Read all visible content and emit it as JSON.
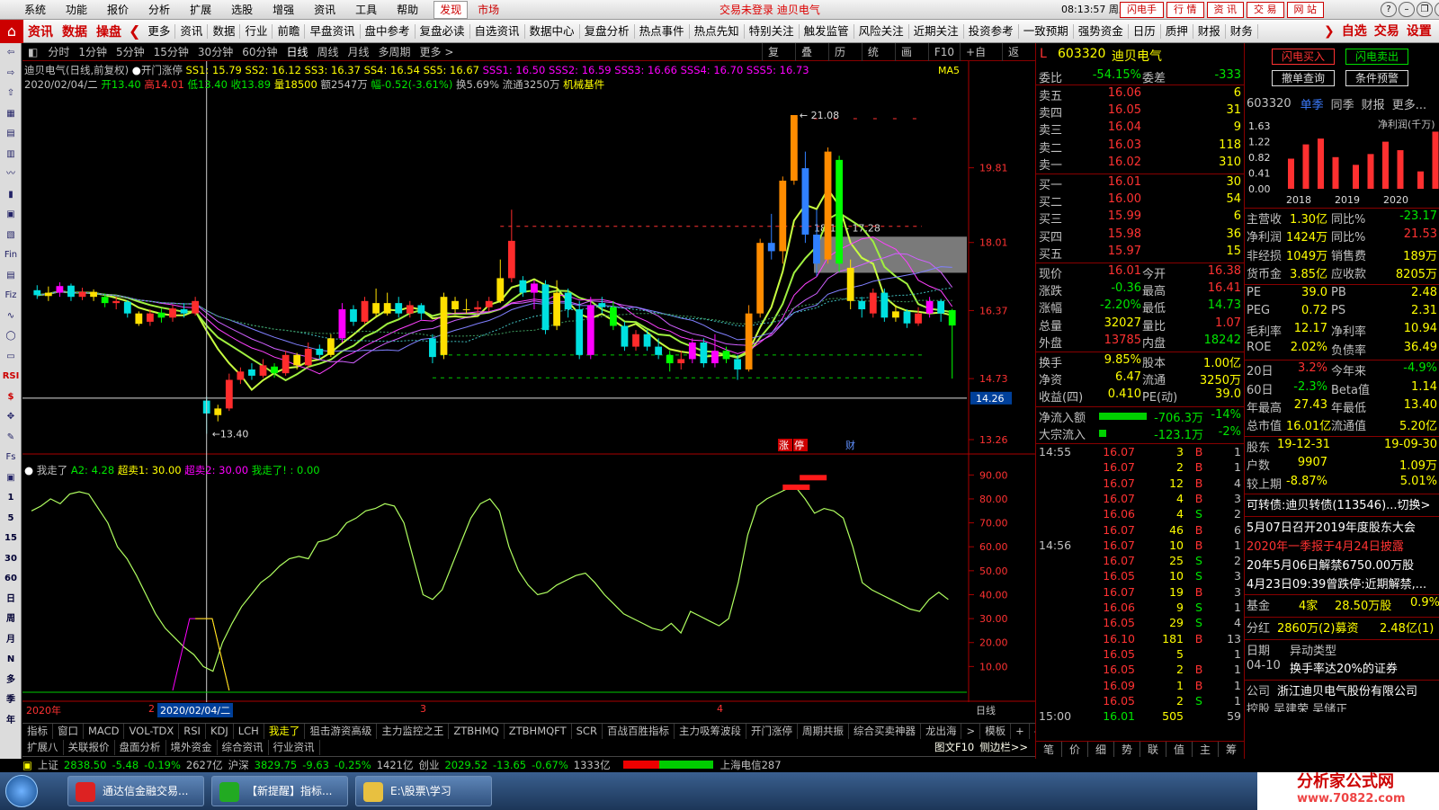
{
  "menubar": {
    "items": [
      "系统",
      "功能",
      "报价",
      "分析",
      "扩展",
      "选股",
      "增强",
      "资讯",
      "工具",
      "帮助"
    ],
    "find": "发现",
    "market": "市场",
    "status": "交易未登录  迪贝电气",
    "clock": "08:13:57 周五",
    "trade_buttons": [
      "闪电手",
      "行 情",
      "资 讯",
      "交 易",
      "网 站"
    ]
  },
  "navbar": {
    "big": [
      "资讯",
      "数据",
      "操盘"
    ],
    "items": [
      "更多",
      "资讯",
      "数据",
      "行业",
      "前瞻",
      "早盘资讯",
      "盘中参考",
      "复盘必读",
      "自选资讯",
      "数据中心",
      "复盘分析",
      "热点事件",
      "热点先知",
      "特别关注",
      "触发监管",
      "风险关注",
      "近期关注",
      "投资参考",
      "一致预期",
      "强势资金",
      "日历",
      "质押",
      "财报",
      "财务"
    ],
    "right": [
      "自选",
      "交易",
      "设置"
    ]
  },
  "lefttb": [
    "⇦",
    "⇨",
    "⇧",
    "▦",
    "▤",
    "▥",
    "〰",
    "▮",
    "▣",
    "▧",
    "Fin",
    "▤",
    "Fiz",
    "∿",
    "◯",
    "▭",
    "RSI",
    "$",
    "✥",
    "✎",
    "Fs",
    "▣",
    "1",
    "5",
    "15",
    "30",
    "60",
    "日",
    "周",
    "月",
    "N",
    "多",
    "季",
    "年"
  ],
  "periodbar": {
    "items": [
      "分时",
      "1分钟",
      "5分钟",
      "15分钟",
      "30分钟",
      "60分钟",
      "日线",
      "周线",
      "月线",
      "多周期",
      "更多 >"
    ],
    "active": 6,
    "tools": [
      "复权",
      "叠加",
      "历史",
      "统计",
      "画线",
      "F10",
      "+自选",
      "返回"
    ]
  },
  "chartinfo": {
    "name": "迪贝电气(日线,前复权)",
    "formula": "开门涨停",
    "ss": "SS1: 15.79  SS2: 16.12  SS3: 16.37  SS4: 16.54  SS5: 16.67",
    "sss": "SSS1: 16.50  SSS2: 16.59  SSS3: 16.66  SSS4: 16.70  SSS5: 16.73",
    "ma": "MA5",
    "date": "2020/02/04/二",
    "open": "开13.40",
    "high": "高14.01",
    "low": "低13.40",
    "close": "收13.89",
    "vol": "量18500",
    "amt": "额2547万",
    "chg": "幅-0.52(-3.61%)",
    "turn": "换5.69%",
    "float": "流通3250万",
    "industry": "机械基件"
  },
  "indicator": {
    "name": "我走了",
    "a2": "A2: 4.28",
    "cs1": "超卖1: 30.00",
    "cs2": "超卖2: 30.00",
    "wz": "我走了! : 0.00"
  },
  "dateaxis": {
    "labels": [
      "2020年",
      "2",
      "2020/02/04/二",
      "3",
      "4"
    ],
    "right": "日线"
  },
  "indtabs": [
    "指标",
    "窗口",
    "MACD",
    "VOL-TDX",
    "RSI",
    "KDJ",
    "LCH",
    "我走了",
    "狙击游资高级",
    "主力监控之王",
    "ZTBHMQ",
    "ZTBHMQFT",
    "SCR",
    "百战百胜指标",
    "主力吸筹波段",
    "开门涨停",
    "周期共振",
    "综合买卖神器",
    "龙出海",
    ">",
    "模板",
    "+",
    "-"
  ],
  "indtabs2": [
    "扩展八",
    "关联报价",
    "盘面分析",
    "境外资金",
    "综合资讯",
    "行业资讯"
  ],
  "indtabs2_right": [
    "图文F10",
    "侧边栏>>"
  ],
  "statusbar": {
    "sh": "上证",
    "sh_v": "2838.50",
    "sh_c": "-5.48",
    "sh_p": "-0.19%",
    "sh_a": "2627亿",
    "hs": "沪深",
    "hs_v": "3829.75",
    "hs_c": "-9.63",
    "hs_p": "-0.25%",
    "hs_a": "1421亿",
    "cy": "创业",
    "cy_v": "2029.52",
    "cy_c": "-13.65",
    "cy_p": "-0.67%",
    "cy_a": "1333亿",
    "tel": "上海电信287"
  },
  "taskbar": [
    "通达信金融交易...",
    "【新提醒】指标...",
    "E:\\股票\\学习"
  ],
  "logo": {
    "t1": "分析家公式网",
    "t2": "www.70822.com"
  },
  "quote": {
    "mark": "L",
    "code": "603320",
    "name": "迪贝电气",
    "wb": {
      "l": "委比",
      "v": "-54.15%",
      "l2": "委差",
      "v2": "-333"
    },
    "asks": [
      {
        "l": "卖五",
        "p": "16.06",
        "v": "6"
      },
      {
        "l": "卖四",
        "p": "16.05",
        "v": "31"
      },
      {
        "l": "卖三",
        "p": "16.04",
        "v": "9"
      },
      {
        "l": "卖二",
        "p": "16.03",
        "v": "118"
      },
      {
        "l": "卖一",
        "p": "16.02",
        "v": "310"
      }
    ],
    "bids": [
      {
        "l": "买一",
        "p": "16.01",
        "v": "30"
      },
      {
        "l": "买二",
        "p": "16.00",
        "v": "54"
      },
      {
        "l": "买三",
        "p": "15.99",
        "v": "6"
      },
      {
        "l": "买四",
        "p": "15.98",
        "v": "36"
      },
      {
        "l": "买五",
        "p": "15.97",
        "v": "15"
      }
    ],
    "stats": [
      {
        "l": "现价",
        "v": "16.01",
        "vc": "red",
        "l2": "今开",
        "v2": "16.38",
        "v2c": "red"
      },
      {
        "l": "涨跌",
        "v": "-0.36",
        "vc": "grn",
        "l2": "最高",
        "v2": "16.41",
        "v2c": "red"
      },
      {
        "l": "涨幅",
        "v": "-2.20%",
        "vc": "grn",
        "l2": "最低",
        "v2": "14.73",
        "v2c": "grn"
      },
      {
        "l": "总量",
        "v": "32027",
        "vc": "yel",
        "l2": "量比",
        "v2": "1.07",
        "v2c": "red"
      },
      {
        "l": "外盘",
        "v": "13785",
        "vc": "red",
        "l2": "内盘",
        "v2": "18242",
        "v2c": "grn"
      }
    ],
    "stats2": [
      {
        "l": "换手",
        "v": "9.85%",
        "l2": "股本",
        "v2": "1.00亿"
      },
      {
        "l": "净资",
        "v": "6.47",
        "l2": "流通",
        "v2": "3250万"
      },
      {
        "l": "收益(四)",
        "v": "0.410",
        "l2": "PE(动)",
        "v2": "39.0"
      }
    ],
    "flow": [
      {
        "l": "净流入额",
        "v": "-706.3万",
        "p": "-14%",
        "bar": 0.75
      },
      {
        "l": "大宗流入",
        "v": "-123.1万",
        "p": "-2%",
        "bar": 0.12
      }
    ],
    "ticks": [
      {
        "t": "14:55",
        "p": "16.07",
        "v": "3",
        "bs": "B",
        "c": "1"
      },
      {
        "t": "",
        "p": "16.07",
        "v": "2",
        "bs": "B",
        "c": "1"
      },
      {
        "t": "",
        "p": "16.07",
        "v": "12",
        "bs": "B",
        "c": "4"
      },
      {
        "t": "",
        "p": "16.07",
        "v": "4",
        "bs": "B",
        "c": "3"
      },
      {
        "t": "",
        "p": "16.06",
        "v": "4",
        "bs": "S",
        "c": "2"
      },
      {
        "t": "",
        "p": "16.07",
        "v": "46",
        "bs": "B",
        "c": "6"
      },
      {
        "t": "14:56",
        "p": "16.07",
        "v": "10",
        "bs": "B",
        "c": "1"
      },
      {
        "t": "",
        "p": "16.07",
        "v": "25",
        "bs": "S",
        "c": "2"
      },
      {
        "t": "",
        "p": "16.05",
        "v": "10",
        "bs": "S",
        "c": "3"
      },
      {
        "t": "",
        "p": "16.07",
        "v": "19",
        "bs": "B",
        "c": "3"
      },
      {
        "t": "",
        "p": "16.06",
        "v": "9",
        "bs": "S",
        "c": "1"
      },
      {
        "t": "",
        "p": "16.05",
        "v": "29",
        "bs": "S",
        "c": "4"
      },
      {
        "t": "",
        "p": "16.10",
        "v": "181",
        "bs": "B",
        "c": "13"
      },
      {
        "t": "",
        "p": "16.05",
        "v": "5",
        "bs": "",
        "c": "1"
      },
      {
        "t": "",
        "p": "16.05",
        "v": "2",
        "bs": "B",
        "c": "1"
      },
      {
        "t": "",
        "p": "16.09",
        "v": "1",
        "bs": "B",
        "c": "1"
      },
      {
        "t": "",
        "p": "16.05",
        "v": "2",
        "bs": "S",
        "c": "1"
      },
      {
        "t": "15:00",
        "p": "16.01",
        "v": "505",
        "bs": "",
        "c": "59"
      }
    ],
    "tabs": [
      "笔",
      "价",
      "细",
      "势",
      "联",
      "值",
      "主",
      "筹"
    ]
  },
  "info": {
    "buttons": [
      "闪电买入",
      "闪电卖出",
      "撤单查询",
      "条件预警"
    ],
    "code": "603320",
    "tabs": [
      "单季",
      "同季",
      "财报",
      "更多..."
    ],
    "chart_title": "净利润(千万)",
    "yticks": [
      "1.63",
      "1.22",
      "0.82",
      "0.41",
      "0.00"
    ],
    "years": [
      "2018",
      "2019",
      "2020"
    ],
    "bars": [
      0.78,
      1.15,
      1.3,
      0.82,
      0.62,
      0.9,
      1.22,
      1.0,
      0.45,
      1.48
    ],
    "rows1": [
      {
        "l": "主营收",
        "v": "1.30亿",
        "l2": "同比%",
        "v2": "-23.17",
        "v2c": "grn"
      },
      {
        "l": "净利润",
        "v": "1424万",
        "l2": "同比%",
        "v2": "21.53",
        "v2c": "red"
      },
      {
        "l": "非经损",
        "v": "1049万",
        "l2": "销售费",
        "v2": "189万",
        "v2c": "yel"
      },
      {
        "l": "货币金",
        "v": "3.85亿",
        "l2": "应收款",
        "v2": "8205万",
        "v2c": "yel"
      }
    ],
    "rows2": [
      {
        "l": "PE",
        "v": "39.0",
        "l2": "PB",
        "v2": "2.48"
      },
      {
        "l": "PEG",
        "v": "0.72",
        "l2": "PS",
        "v2": "2.31"
      },
      {
        "l": "毛利率",
        "v": "12.17",
        "l2": "净利率",
        "v2": "10.94"
      },
      {
        "l": "ROE",
        "v": "2.02%",
        "l2": "负债率",
        "v2": "36.49"
      }
    ],
    "rows3": [
      {
        "l": "20日",
        "v": "3.2%",
        "vc": "red",
        "l2": "今年来",
        "v2": "-4.9%",
        "v2c": "grn"
      },
      {
        "l": "60日",
        "v": "-2.3%",
        "vc": "grn",
        "l2": "Beta值",
        "v2": "1.14",
        "v2c": "yel"
      },
      {
        "l": "年最高",
        "v": "27.43",
        "vc": "yel",
        "l2": "年最低",
        "v2": "13.40",
        "v2c": "yel"
      },
      {
        "l": "总市值",
        "v": "16.01亿",
        "vc": "yel",
        "l2": "流通值",
        "v2": "5.20亿",
        "v2c": "yel"
      }
    ],
    "rows4": [
      {
        "l": "股东",
        "v": "19-12-31",
        "l2": "",
        "v2": "19-09-30"
      },
      {
        "l": "户数",
        "v": "9907",
        "l2": "",
        "v2": "1.09万"
      },
      {
        "l": "较上期",
        "v": "-8.87%",
        "l2": "",
        "v2": "5.01%"
      }
    ],
    "bond": "可转债:迪贝转债(113546)...切换>",
    "news": [
      {
        "t": "5月07日召开2019年度股东大会",
        "c": "wht"
      },
      {
        "t": "2020年一季报于4月24日披露",
        "c": "red"
      },
      {
        "t": "20年5月06日解禁6750.00万股",
        "c": "wht"
      },
      {
        "t": "4月23日09:39曾跌停:近期解禁,...",
        "c": "wht"
      }
    ],
    "fund": {
      "l": "基金",
      "v": "4家",
      "v2": "28.50万股",
      "v3": "0.9%"
    },
    "div": {
      "l": "分红",
      "v": "2860万(2)募资",
      "v2": "2.48亿(1)"
    },
    "event": {
      "l": "日期",
      "v": "异动类型",
      "l2": "04-10",
      "v2": "换手率达20%的证券"
    },
    "company": {
      "l": "公司",
      "v": "浙江迪贝电气股份有限公司"
    },
    "last": "控股  吴建荣  吴储正"
  },
  "chart_data": {
    "type": "candlestick",
    "series_name": "迪贝电气(日线,前复权)",
    "y_ticks": [
      "19.81",
      "18.01",
      "16.37",
      "14.73",
      "13.26"
    ],
    "y_min": 13.0,
    "y_max": 21.6,
    "last_price_label": "14.26",
    "annotations": {
      "high": "21.08",
      "low": "13.40",
      "range": "18.15 - 17.28",
      "zhang": "涨",
      "ting": "停",
      "cai": "财"
    },
    "candles": [
      [
        16.86,
        16.74,
        16.98,
        16.65
      ],
      [
        16.72,
        16.8,
        16.95,
        16.6
      ],
      [
        16.8,
        16.96,
        17.05,
        16.7
      ],
      [
        16.97,
        16.7,
        17.02,
        16.6
      ],
      [
        16.7,
        16.82,
        16.92,
        16.62
      ],
      [
        16.82,
        16.7,
        16.88,
        16.6
      ],
      [
        16.7,
        16.55,
        16.78,
        16.45
      ],
      [
        16.55,
        16.6,
        16.7,
        16.4
      ],
      [
        16.58,
        16.3,
        16.62,
        16.2
      ],
      [
        16.3,
        16.05,
        16.35,
        16.0
      ],
      [
        16.1,
        16.3,
        16.4,
        16.0
      ],
      [
        16.32,
        16.2,
        16.42,
        16.08
      ],
      [
        16.2,
        16.42,
        16.5,
        16.1
      ],
      [
        16.4,
        16.3,
        16.55,
        16.2
      ],
      [
        16.3,
        16.6,
        16.7,
        16.25
      ],
      [
        14.2,
        13.89,
        14.3,
        13.4
      ],
      [
        13.85,
        14.01,
        14.1,
        13.7
      ],
      [
        14.01,
        14.7,
        14.85,
        13.95
      ],
      [
        14.7,
        14.9,
        15.0,
        14.6
      ],
      [
        14.95,
        14.8,
        15.1,
        14.7
      ],
      [
        14.8,
        15.05,
        15.2,
        14.75
      ],
      [
        15.02,
        14.86,
        15.1,
        14.75
      ],
      [
        14.86,
        15.3,
        15.4,
        14.8
      ],
      [
        15.3,
        15.05,
        15.35,
        14.95
      ],
      [
        15.05,
        15.45,
        15.6,
        15.0
      ],
      [
        15.45,
        15.3,
        15.55,
        15.2
      ],
      [
        15.3,
        15.7,
        15.8,
        15.25
      ],
      [
        15.7,
        16.4,
        16.55,
        15.6
      ],
      [
        16.4,
        16.1,
        16.5,
        16.0
      ],
      [
        16.1,
        16.6,
        16.7,
        16.05
      ],
      [
        16.55,
        16.3,
        16.9,
        16.2
      ],
      [
        16.3,
        16.55,
        16.8,
        16.25
      ],
      [
        16.55,
        16.3,
        16.7,
        16.2
      ],
      [
        16.3,
        16.5,
        16.6,
        16.2
      ],
      [
        16.5,
        16.3,
        16.55,
        16.15
      ],
      [
        15.7,
        15.25,
        15.8,
        15.1
      ],
      [
        15.3,
        16.7,
        16.8,
        15.2
      ],
      [
        16.6,
        16.4,
        16.7,
        16.3
      ],
      [
        16.4,
        16.38,
        16.65,
        16.3
      ],
      [
        16.4,
        16.45,
        16.6,
        16.3
      ],
      [
        16.45,
        16.6,
        16.7,
        16.35
      ],
      [
        16.6,
        17.15,
        17.6,
        16.55
      ],
      [
        17.15,
        18.05,
        18.8,
        17.05
      ],
      [
        17.1,
        16.8,
        17.2,
        16.7
      ],
      [
        16.8,
        17.02,
        17.1,
        16.4
      ],
      [
        17.0,
        15.9,
        17.1,
        15.8
      ],
      [
        16.0,
        16.8,
        17.1,
        15.9
      ],
      [
        16.8,
        16.4,
        16.9,
        16.2
      ],
      [
        16.4,
        15.3,
        16.6,
        15.2
      ],
      [
        15.3,
        16.5,
        16.7,
        15.2
      ],
      [
        16.55,
        16.45,
        16.7,
        16.3
      ],
      [
        16.45,
        16.0,
        16.6,
        15.9
      ],
      [
        16.0,
        15.5,
        16.1,
        15.4
      ],
      [
        15.5,
        15.8,
        15.9,
        15.4
      ],
      [
        15.8,
        15.5,
        15.9,
        15.4
      ],
      [
        15.5,
        15.3,
        15.7,
        15.2
      ],
      [
        15.3,
        15.1,
        15.4,
        14.9
      ],
      [
        15.1,
        15.2,
        15.4,
        14.95
      ],
      [
        15.2,
        15.6,
        15.7,
        15.1
      ],
      [
        15.6,
        15.1,
        15.7,
        15.0
      ],
      [
        15.1,
        15.4,
        15.8,
        15.0
      ],
      [
        15.4,
        15.2,
        15.5,
        15.1
      ],
      [
        15.2,
        14.95,
        15.3,
        14.7
      ],
      [
        14.95,
        16.3,
        16.5,
        14.9
      ],
      [
        16.3,
        18.0,
        18.1,
        16.2
      ],
      [
        18.0,
        17.8,
        18.7,
        17.6
      ],
      [
        17.8,
        19.5,
        19.6,
        17.5
      ],
      [
        19.5,
        21.08,
        21.08,
        19.4
      ],
      [
        19.8,
        18.2,
        20.2,
        18.0
      ],
      [
        18.2,
        17.5,
        18.8,
        17.2
      ],
      [
        17.6,
        20.2,
        20.3,
        17.5
      ],
      [
        20.0,
        17.5,
        20.1,
        17.3
      ],
      [
        17.4,
        16.6,
        17.6,
        16.4
      ],
      [
        16.6,
        16.4,
        16.7,
        16.2
      ],
      [
        16.3,
        16.8,
        16.9,
        16.2
      ],
      [
        16.8,
        16.2,
        16.9,
        16.1
      ],
      [
        16.2,
        16.35,
        16.5,
        16.1
      ],
      [
        16.35,
        16.06,
        16.4,
        15.95
      ],
      [
        16.06,
        16.3,
        16.45,
        16.0
      ],
      [
        16.3,
        16.6,
        16.7,
        16.2
      ],
      [
        16.6,
        16.3,
        16.65,
        16.1
      ],
      [
        16.38,
        16.01,
        16.41,
        14.73
      ]
    ],
    "indicator_series": {
      "name": "我走了",
      "y_ticks": [
        "90.00",
        "80.00",
        "70.00",
        "60.00",
        "50.00",
        "40.00",
        "30.00",
        "20.00",
        "10.00"
      ],
      "y_min": 0,
      "y_max": 95,
      "values": [
        75,
        77,
        80,
        78,
        82,
        83,
        82,
        76,
        70,
        60,
        55,
        48,
        40,
        32,
        26,
        22,
        18,
        15,
        10,
        8,
        20,
        28,
        35,
        40,
        45,
        48,
        52,
        55,
        56,
        55,
        62,
        63,
        65,
        70,
        72,
        75,
        76,
        78,
        77,
        70,
        55,
        40,
        38,
        42,
        52,
        62,
        72,
        78,
        80,
        75,
        60,
        50,
        44,
        40,
        41,
        44,
        46,
        48,
        49,
        45,
        40,
        36,
        32,
        30,
        28,
        26,
        25,
        28,
        24,
        33,
        31,
        29,
        27,
        30,
        45,
        65,
        77,
        80,
        82,
        84,
        85,
        80,
        74,
        76,
        75,
        72,
        60,
        45,
        42,
        40,
        38,
        36,
        34,
        33,
        38,
        41,
        38
      ]
    }
  }
}
